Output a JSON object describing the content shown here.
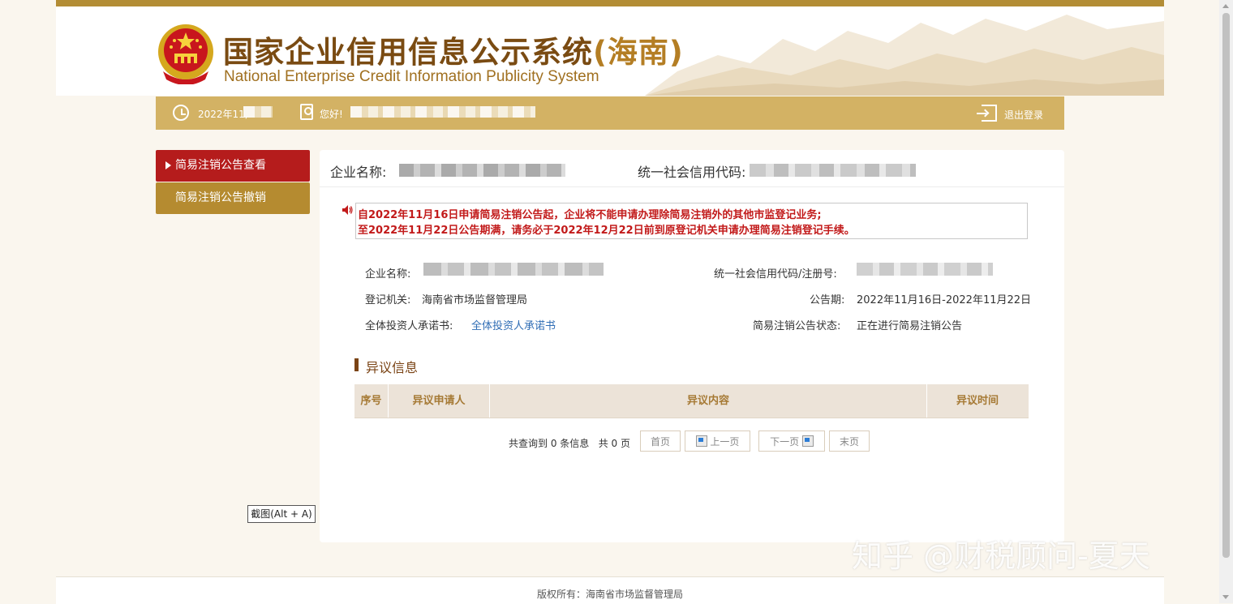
{
  "site": {
    "title_main": "国家企业信用信息公示系统",
    "title_region": "(海南)",
    "subtitle": "National Enterprise Credit Information Publicity System"
  },
  "userbar": {
    "date": "2022年11,",
    "greeting": "您好!",
    "logout_label": "退出登录"
  },
  "sidebar": {
    "items": [
      {
        "label": "简易注销公告查看",
        "active": true
      },
      {
        "label": "简易注销公告撤销",
        "active": false
      }
    ]
  },
  "panel": {
    "company_label": "企业名称:",
    "credit_code_label": "统一社会信用代码:"
  },
  "notice": {
    "line1": "自2022年11月16日申请简易注销公告起，企业将不能申请办理除简易注销外的其他市监登记业务;",
    "line2": "至2022年11月22日公告期满，请务必于2022年12月22日前到原登记机关申请办理简易注销登记手续。"
  },
  "info": {
    "company_name_label": "企业名称:",
    "code_label": "统一社会信用代码/注册号:",
    "authority_label": "登记机关:",
    "authority_value": "海南省市场监督管理局",
    "period_label": "公告期:",
    "period_value": "2022年11月16日-2022年11月22日",
    "commitment_label": "全体投资人承诺书:",
    "commitment_link": "全体投资人承诺书",
    "status_label": "简易注销公告状态:",
    "status_value": "正在进行简易注销公告"
  },
  "objection": {
    "section_title": "异议信息",
    "columns": [
      "序号",
      "异议申请人",
      "异议内容",
      "异议时间"
    ],
    "rows": []
  },
  "pagination": {
    "summary": "共查询到 0 条信息   共 0 页",
    "first": "首页",
    "prev": "上一页",
    "next": "下一页",
    "last": "末页"
  },
  "tooltip": {
    "text": "截图(Alt + A)"
  },
  "footer": {
    "copyright": "版权所有：海南省市场监督管理局"
  },
  "watermark": {
    "text": "知乎 @财税顾问-夏天"
  },
  "colors": {
    "brand_gold": "#d3b264",
    "active_menu": "#b51c1c",
    "menu_gold": "#b58b30",
    "notice_red": "#c21a1a",
    "link_blue": "#2f6db5"
  }
}
